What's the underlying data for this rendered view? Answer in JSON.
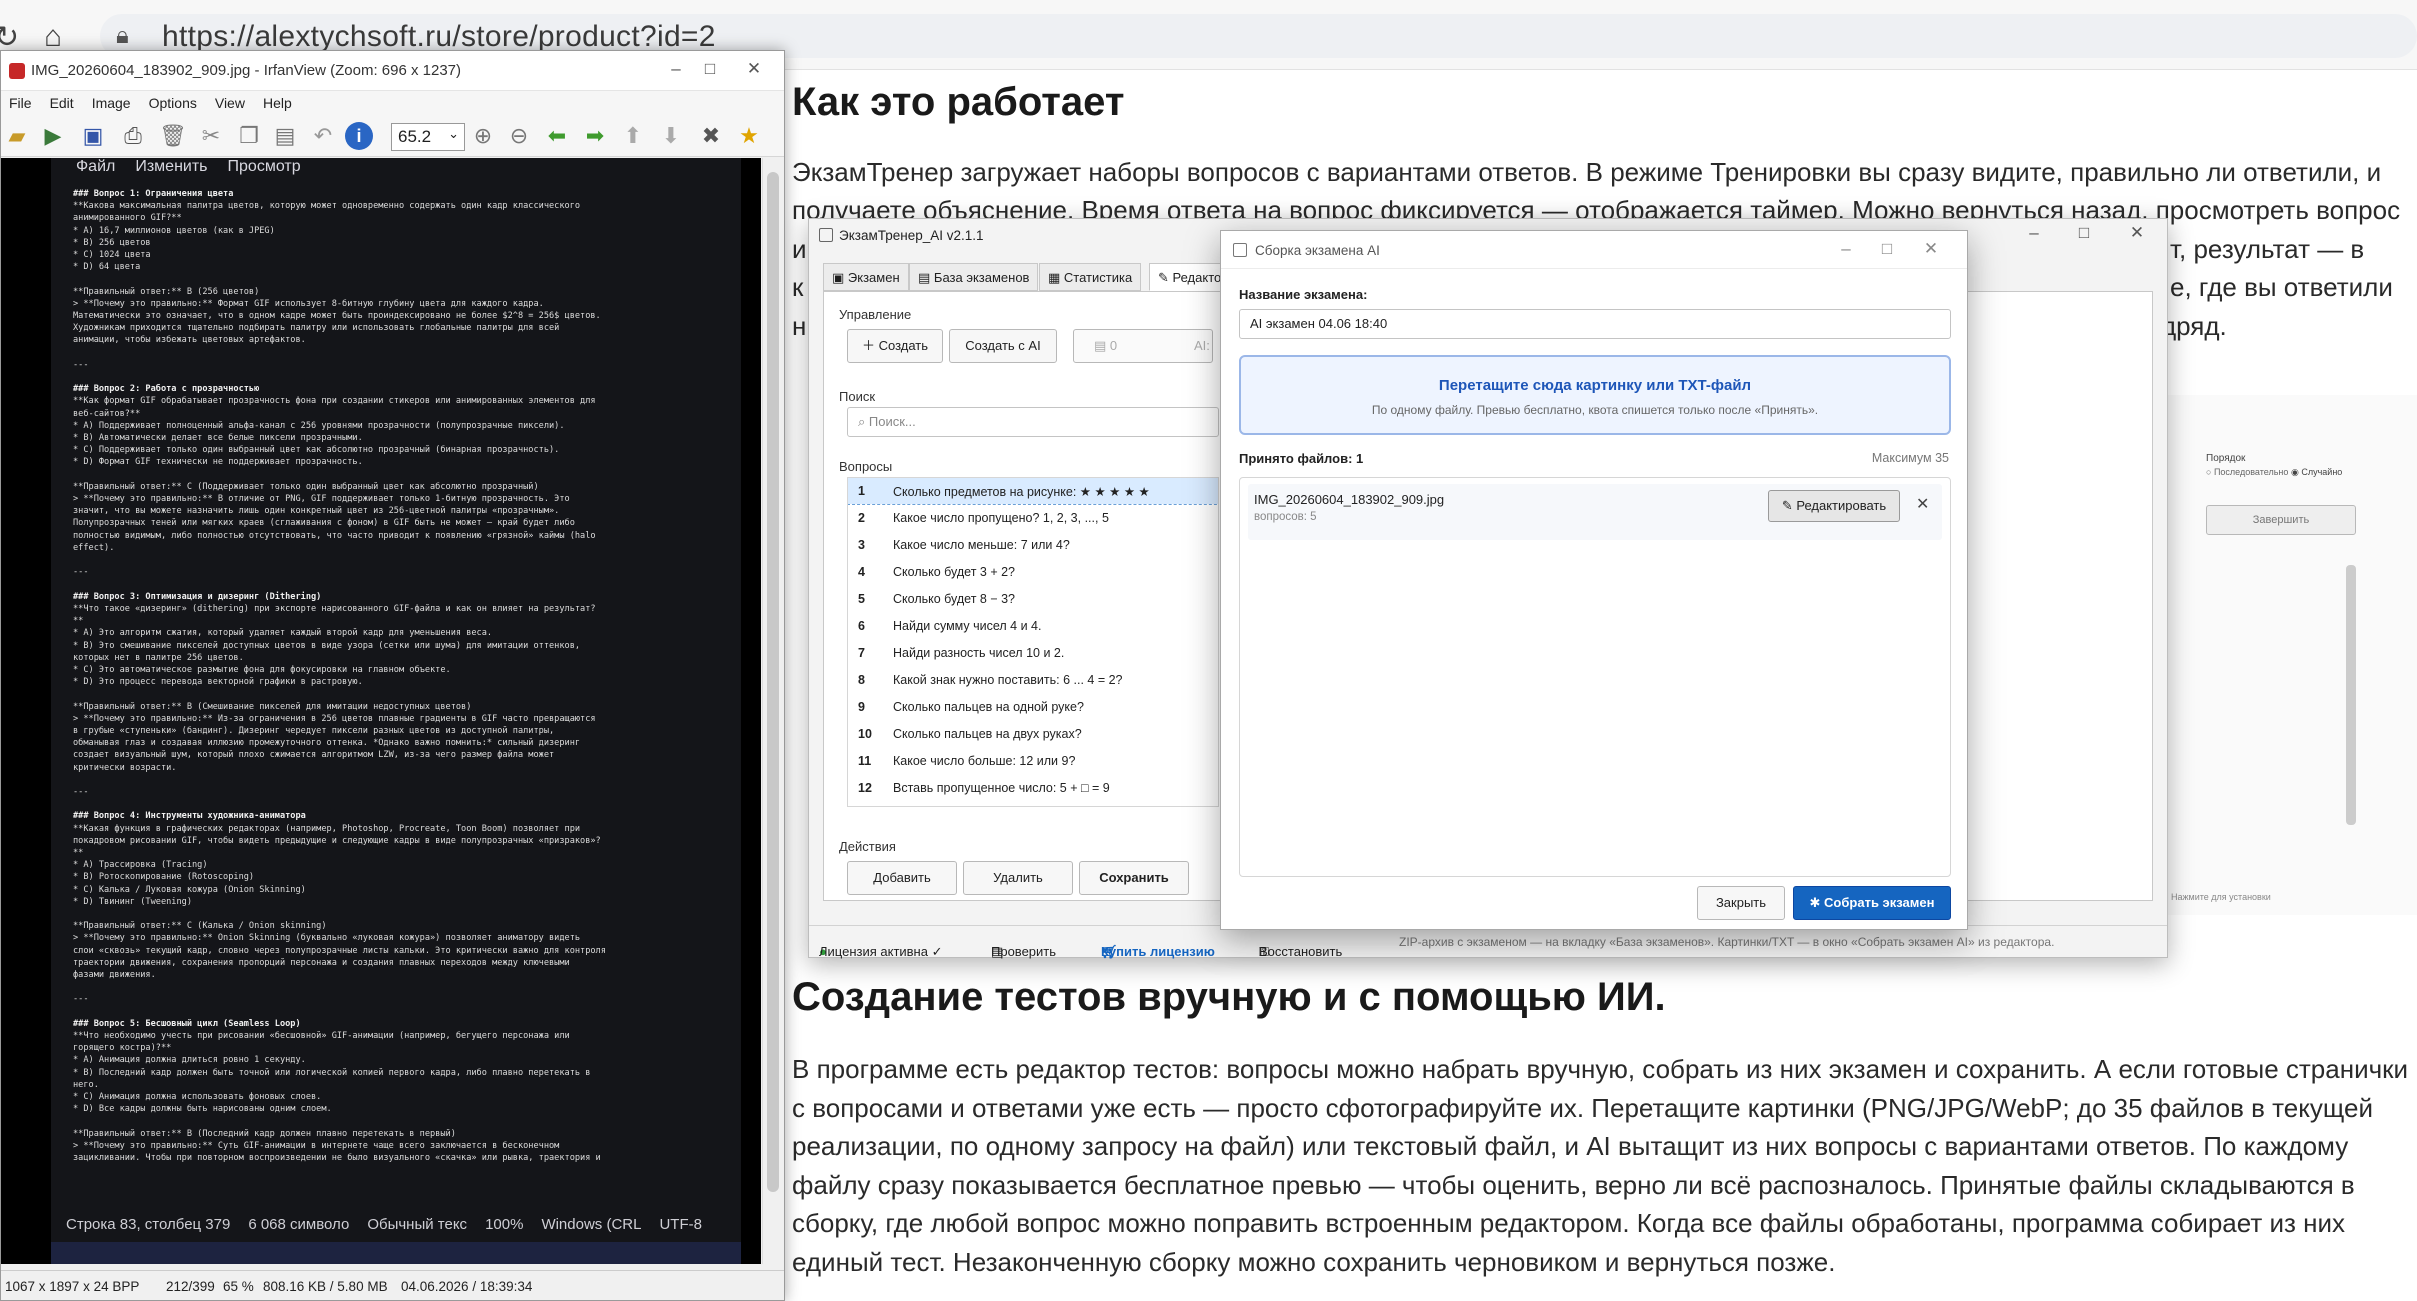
{
  "browser": {
    "url": "https://alextychsoft.ru/store/product?id=2"
  },
  "article": {
    "heading1": "Как это работает",
    "para1": [
      "ЭкзамТренер загружает наборы вопросов с вариантами ответов. В режиме Тренировки вы сразу видите, правильно ли ответили, и",
      "получаете объяснение. Время ответа на вопрос фиксируется — отображается таймер. Можно вернуться назад, просмотреть вопрос",
      "и",
      "к",
      "н"
    ],
    "para1_right": [
      "т, результат — в",
      "е, где вы ответили",
      "подряд."
    ],
    "heading2": "Создание тестов вручную и с помощью ИИ.",
    "para2": [
      "В программе есть редактор тестов: вопросы можно набрать вручную, собрать из них экзамен и сохранить. А если готовые странички",
      "с вопросами и ответами уже есть — просто сфотографируйте их. Перетащите картинки (PNG/JPG/WebP; до 35 файлов в текущей",
      "реализации, по одному запросу на файл) или текстовый файл, и AI вытащит из них вопросы с вариантами ответов. По каждому",
      "файлу сразу показывается бесплатное превью — чтобы оценить, верно ли всё распозналось. Принятые файлы складываются в",
      "сборку, где любой вопрос можно поправить встроенным редактором. Когда все файлы обработаны, программа собирает из них",
      "единый тест. Незаконченную сборку можно сохранить черновиком и вернуться позже."
    ]
  },
  "irfan": {
    "title": "IMG_20260604_183902_909.jpg - IrfanView (Zoom: 696 x 1237)",
    "menu": [
      "File",
      "Edit",
      "Image",
      "Options",
      "View",
      "Help"
    ],
    "zoom": "65.2",
    "status": {
      "dims": "1067 x 1897 x 24 BPP",
      "index": "212/399",
      "zoom": "65 %",
      "size": "808.16 KB / 5.80 MB",
      "date": "04.06.2026 / 18:39:34"
    },
    "photo": {
      "editor_menu": [
        "Файл",
        "Изменить",
        "Просмотр"
      ],
      "editor_status": [
        "Строка 83, столбец 379",
        "6 068 символо",
        "Обычный текс",
        "100%",
        "Windows (CRL",
        "UTF-8"
      ]
    }
  },
  "exam": {
    "title": "ЭкзамТренер_AI v2.1.1",
    "tabs": [
      "Экзамен",
      "База экзаменов",
      "Статистика",
      "Редактор"
    ],
    "manage_label": "Управление",
    "create_btn": "Создать",
    "create_ai_btn": "Создать с AI",
    "count_value": "0",
    "ai_label": "AI:",
    "search_label": "Поиск",
    "search_placeholder": "Поиск...",
    "questions_label": "Вопросы",
    "questions": [
      {
        "n": "1",
        "t": "Сколько предметов на рисунке: ★ ★ ★ ★ ★"
      },
      {
        "n": "2",
        "t": "Какое число пропущено? 1, 2, 3, ..., 5"
      },
      {
        "n": "3",
        "t": "Какое число меньше: 7 или 4?"
      },
      {
        "n": "4",
        "t": "Сколько будет 3 + 2?"
      },
      {
        "n": "5",
        "t": "Сколько будет 8 − 3?"
      },
      {
        "n": "6",
        "t": "Найди сумму чисел 4 и 4."
      },
      {
        "n": "7",
        "t": "Найди разность чисел 10 и 2."
      },
      {
        "n": "8",
        "t": "Какой знак нужно поставить: 6 ... 4 = 2?"
      },
      {
        "n": "9",
        "t": "Сколько пальцев на одной руке?"
      },
      {
        "n": "10",
        "t": "Сколько пальцев на двух руках?"
      },
      {
        "n": "11",
        "t": "Какое число больше: 12 или 9?"
      },
      {
        "n": "12",
        "t": "Вставь пропущенное число: 5 + □ = 9"
      }
    ],
    "actions_label": "Действия",
    "add_btn": "Добавить",
    "delete_btn": "Удалить",
    "save_btn": "Сохранить",
    "status": {
      "license": "Лицензия активна ✓",
      "check": "Проверить",
      "buy": "Купить лицензию",
      "restore": "Восстановить",
      "hint": "ZIP-архив с экзаменом — на вкладку «База экзаменов». Картинки/TXT — в окно «Собрать экзамен AI» из редактора."
    },
    "right_panel": {
      "order_label": "Порядок",
      "order_seq": "Последовательно",
      "order_rand": "Случайно",
      "finish_btn": "Завершить",
      "install_hint": "Нажмите для установки"
    }
  },
  "dialog": {
    "title": "Сборка экзамена AI",
    "name_label": "Название экзамена:",
    "name_value": "AI экзамен 04.06 18:40",
    "drop_title": "Перетащите сюда картинку или TXT-файл",
    "drop_sub": "По одному файлу. Превью бесплатно, квота спишется только после «Принять».",
    "accepted": "Принято файлов: 1",
    "max": "Максимум 35",
    "file_name": "IMG_20260604_183902_909.jpg",
    "file_questions": "вопросов: 5",
    "edit_btn": "Редактировать",
    "close_btn": "Закрыть",
    "build_btn": "Собрать экзамен"
  },
  "colors": {
    "accent": "#1565c0",
    "license_ok": "#2e9b3a"
  }
}
